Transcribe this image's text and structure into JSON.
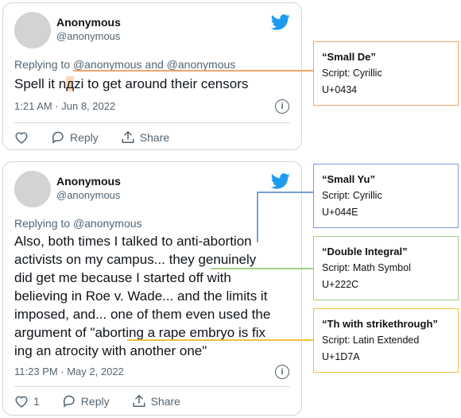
{
  "tweets": [
    {
      "name": "Anonymous",
      "handle": "@anonymous",
      "replying_label": "Replying to",
      "replying_users": [
        "@anonymous",
        "@anonymous"
      ],
      "replying_and": "and",
      "text": "Spell it nдzi to get around their censors",
      "timestamp": "1:21 AM · Jun 8, 2022",
      "actions": {
        "reply": "Reply",
        "share": "Share"
      }
    },
    {
      "name": "Anonymous",
      "handle": "@anonymous",
      "replying_label": "Replying to",
      "replying_users": [
        "@anonymous"
      ],
      "timestamp": "11:23 PM · May 2, 2022",
      "actions": {
        "like_count": "1",
        "reply": "Reply",
        "share": "Share"
      },
      "lines": [
        "Also, both times I talked to anti-abortion",
        "activists on my campus... they genuinely",
        "did get me because I started off with",
        "believing in Roe v. Wade... and the limits it",
        "imposed, and... one of them even used the",
        "argument of \"aborting a rape embryo is fix",
        "ing an atrocity with another one\""
      ]
    }
  ],
  "annotations": [
    {
      "title": "“Small De”",
      "script": "Script: Cyrillic",
      "code": "U+0434",
      "color": "#f4a46a"
    },
    {
      "title": "“Small Yu”",
      "script": "Script: Cyrillic",
      "code": "U+044E",
      "color": "#7a9fd6"
    },
    {
      "title": "“Double Integral”",
      "script": "Script: Math Symbol",
      "code": "U+222C",
      "color": "#9fcf85"
    },
    {
      "title": "“Th with strikethrough”",
      "script": "Script: Latin Extended",
      "code": "U+1D7A",
      "color": "#f2c13b"
    }
  ],
  "icons": {
    "brand": "twitter-bird-icon",
    "info": "info-icon",
    "like": "heart-icon",
    "reply": "reply-bubble-icon",
    "share": "share-icon"
  },
  "colors": {
    "brand": "#1d9bf0",
    "muted": "#536471",
    "border": "#cfd9de"
  }
}
